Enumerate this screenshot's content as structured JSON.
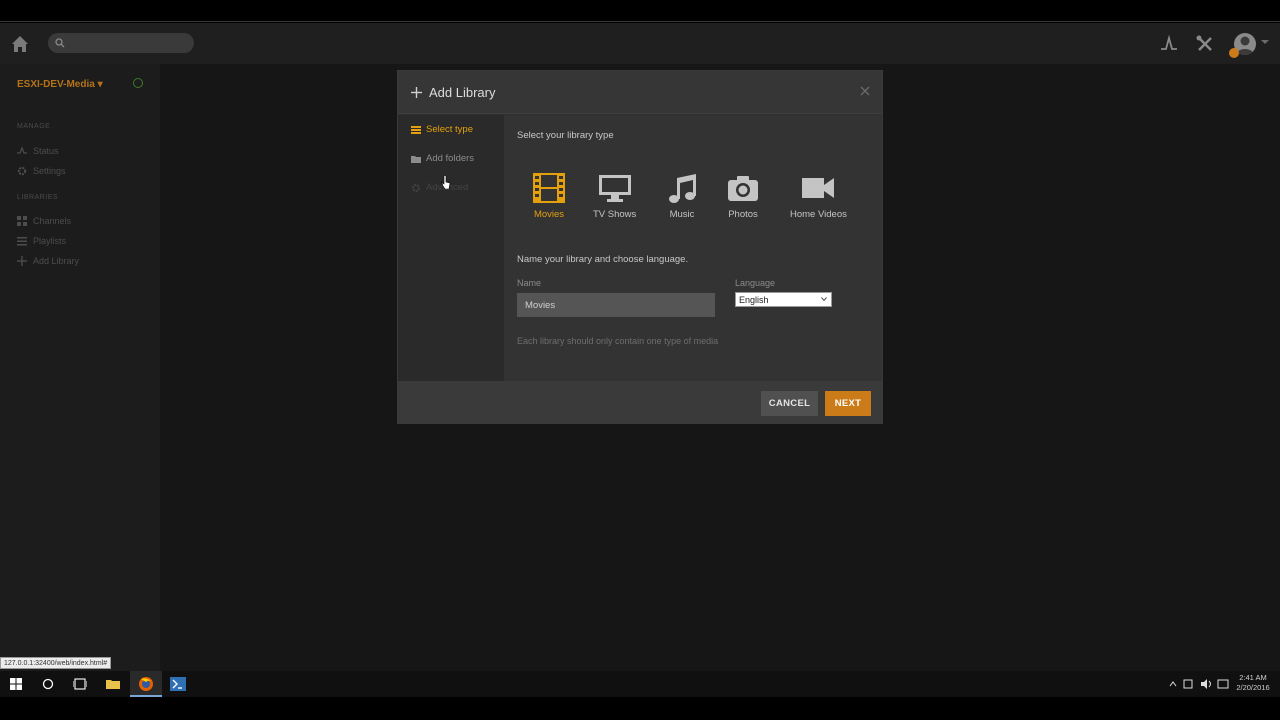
{
  "navbar": {
    "search_placeholder": ""
  },
  "sidebar": {
    "server_name": "ESXI-DEV-Media",
    "manage_header": "MANAGE",
    "manage_items": [
      {
        "label": "Status",
        "icon": "activity-icon"
      },
      {
        "label": "Settings",
        "icon": "gear-icon"
      }
    ],
    "libraries_header": "LIBRARIES",
    "library_items": [
      {
        "label": "Channels",
        "icon": "grid-icon"
      },
      {
        "label": "Playlists",
        "icon": "list-icon"
      },
      {
        "label": "Add Library",
        "icon": "plus-icon"
      }
    ]
  },
  "modal": {
    "title": "Add Library",
    "nav": [
      {
        "label": "Select type",
        "state": "active"
      },
      {
        "label": "Add folders",
        "state": "normal"
      },
      {
        "label": "Advanced",
        "state": "disabled"
      }
    ],
    "select_type_label": "Select your library type",
    "types": [
      {
        "label": "Movies",
        "icon": "film-icon",
        "selected": true
      },
      {
        "label": "TV Shows",
        "icon": "monitor-icon",
        "selected": false
      },
      {
        "label": "Music",
        "icon": "music-icon",
        "selected": false
      },
      {
        "label": "Photos",
        "icon": "camera-icon",
        "selected": false
      },
      {
        "label": "Home Videos",
        "icon": "video-camera-icon",
        "selected": false
      }
    ],
    "name_section_label": "Name your library and choose language.",
    "name_label": "Name",
    "name_value": "Movies",
    "language_label": "Language",
    "language_value": "English",
    "hint": "Each library should only contain one type of media",
    "cancel_label": "CANCEL",
    "next_label": "NEXT"
  },
  "status_url": "127.0.0.1:32400/web/index.html#",
  "taskbar": {
    "clock_time": "2:41 AM",
    "clock_date": "2/20/2016"
  },
  "colors": {
    "accent": "#cc7b19",
    "active_type": "#e5a00d",
    "inactive_type": "#c4c4c4",
    "background": "#1a1a1a"
  }
}
